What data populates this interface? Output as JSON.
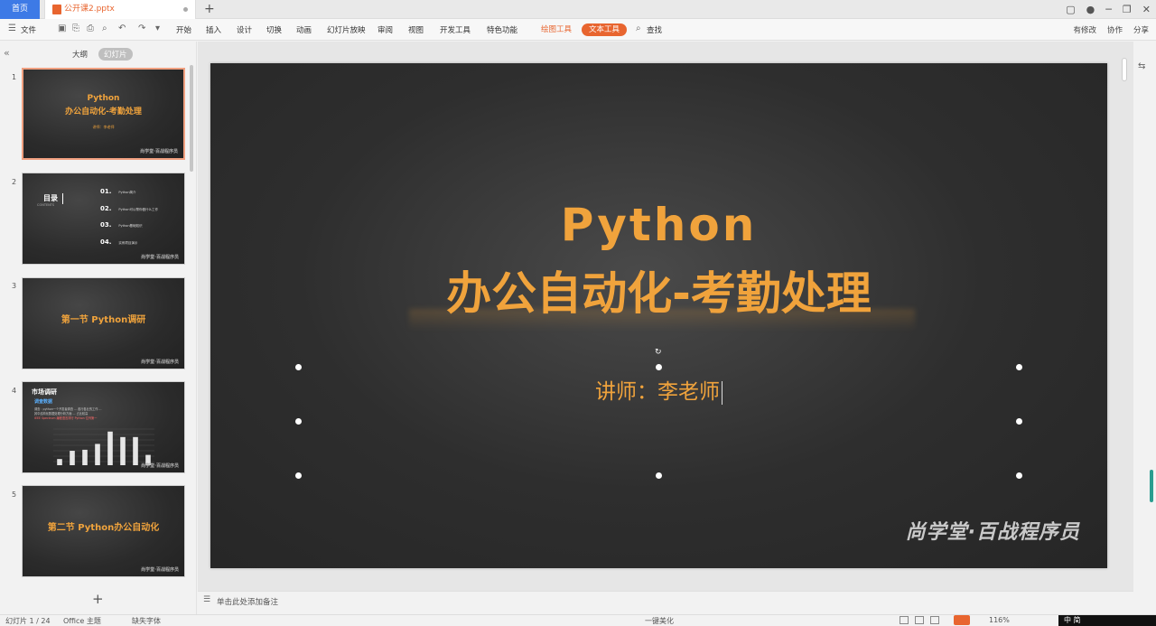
{
  "titlebar": {
    "home_tab": "首页",
    "doc_tab": "公开课2.pptx",
    "new_tab": "+",
    "icons": [
      "tile-icon",
      "avatar-icon",
      "minimize-icon",
      "restore-icon",
      "close-icon"
    ]
  },
  "menu": {
    "file": "文件",
    "items": [
      "开始",
      "插入",
      "设计",
      "切换",
      "动画",
      "幻灯片放映",
      "审阅",
      "视图",
      "开发工具",
      "特色功能"
    ],
    "draw_tools": "绘图工具",
    "text_tools": "文本工具",
    "search": "查找",
    "right": {
      "changes": "有修改",
      "collab": "协作",
      "share": "分享"
    }
  },
  "left_panel": {
    "outline_tab": "大纲",
    "slides_tab": "幻灯片",
    "add": "+",
    "thumbs": [
      {
        "num": "1",
        "title1": "Python",
        "title2": "办公自动化-考勤处理",
        "sub": "讲师：李老师",
        "wm": "尚学堂·百战程序员"
      },
      {
        "num": "2",
        "toc_title": "目录",
        "toc_sub": "CONTENTS",
        "items": [
          {
            "n": "01.",
            "t": "Python简介"
          },
          {
            "n": "02.",
            "t": "Python可以帮你做什么工作"
          },
          {
            "n": "03.",
            "t": "Python基础知识"
          },
          {
            "n": "04.",
            "t": "实例项目演示"
          }
        ],
        "wm": "尚学堂·百战程序员"
      },
      {
        "num": "3",
        "title": "第一节 Python调研",
        "wm": "尚学堂·百战程序员"
      },
      {
        "num": "4",
        "title": "市场调研",
        "sub": "调查数据",
        "lines": [
          "调查：python一个开发者调查 ... 各行各业的工作 ...",
          "其中结构化数据处理分析方面 ... 占比较高"
        ],
        "red": "IEEE Spectrum 编程语言排行 Python 位列第一",
        "wm": "尚学堂·百战程序员"
      },
      {
        "num": "5",
        "title": "第二节 Python办公自动化",
        "wm": "尚学堂·百战程序员"
      }
    ]
  },
  "slide": {
    "title1": "Python",
    "title2": "办公自动化-考勤处理",
    "lecturer": "讲师：李老师",
    "watermark": "尚学堂·百战程序员"
  },
  "notes": {
    "placeholder": "单击此处添加备注"
  },
  "status": {
    "slide_count": "幻灯片 1 / 24",
    "theme": "Office 主题",
    "missing_font": "缺失字体",
    "beautify": "一键美化",
    "zoom": "116%",
    "ime": "中 简"
  },
  "chart_thumb4": {
    "values": [
      0.18,
      0.42,
      0.45,
      0.62,
      0.98,
      0.82,
      0.82,
      0.3
    ]
  }
}
